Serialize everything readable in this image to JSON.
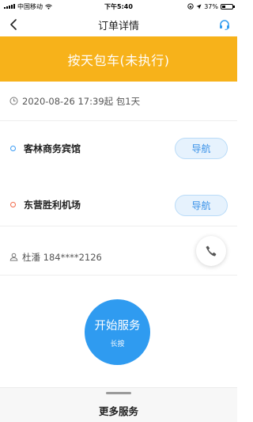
{
  "status_bar": {
    "carrier": "中国移动",
    "time": "下午5:40",
    "battery": "37%",
    "battery_level": 0.37
  },
  "nav": {
    "title": "订单详情"
  },
  "banner": {
    "text": "按天包车(未执行)"
  },
  "trip": {
    "time_text": "2020-08-26 17:39起 包1天",
    "start_location": "客林商务宾馆",
    "end_location": "东营胜利机场",
    "nav_label": "导航"
  },
  "contact": {
    "text": "杜潘 184****2126"
  },
  "action": {
    "main_label": "开始服务",
    "sub_label": "长按"
  },
  "bottom": {
    "more_label": "更多服务"
  },
  "colors": {
    "banner": "#f7b21a",
    "accent_blue": "#2f9bf0",
    "start_dot": "#3a9bf4",
    "end_dot": "#f26a4b"
  },
  "icons": [
    "signal-icon",
    "wifi-icon",
    "lock-rotation-icon",
    "location-arrow-icon",
    "battery-icon",
    "back-chevron-icon",
    "headset-icon",
    "clock-icon",
    "person-icon",
    "phone-icon"
  ]
}
